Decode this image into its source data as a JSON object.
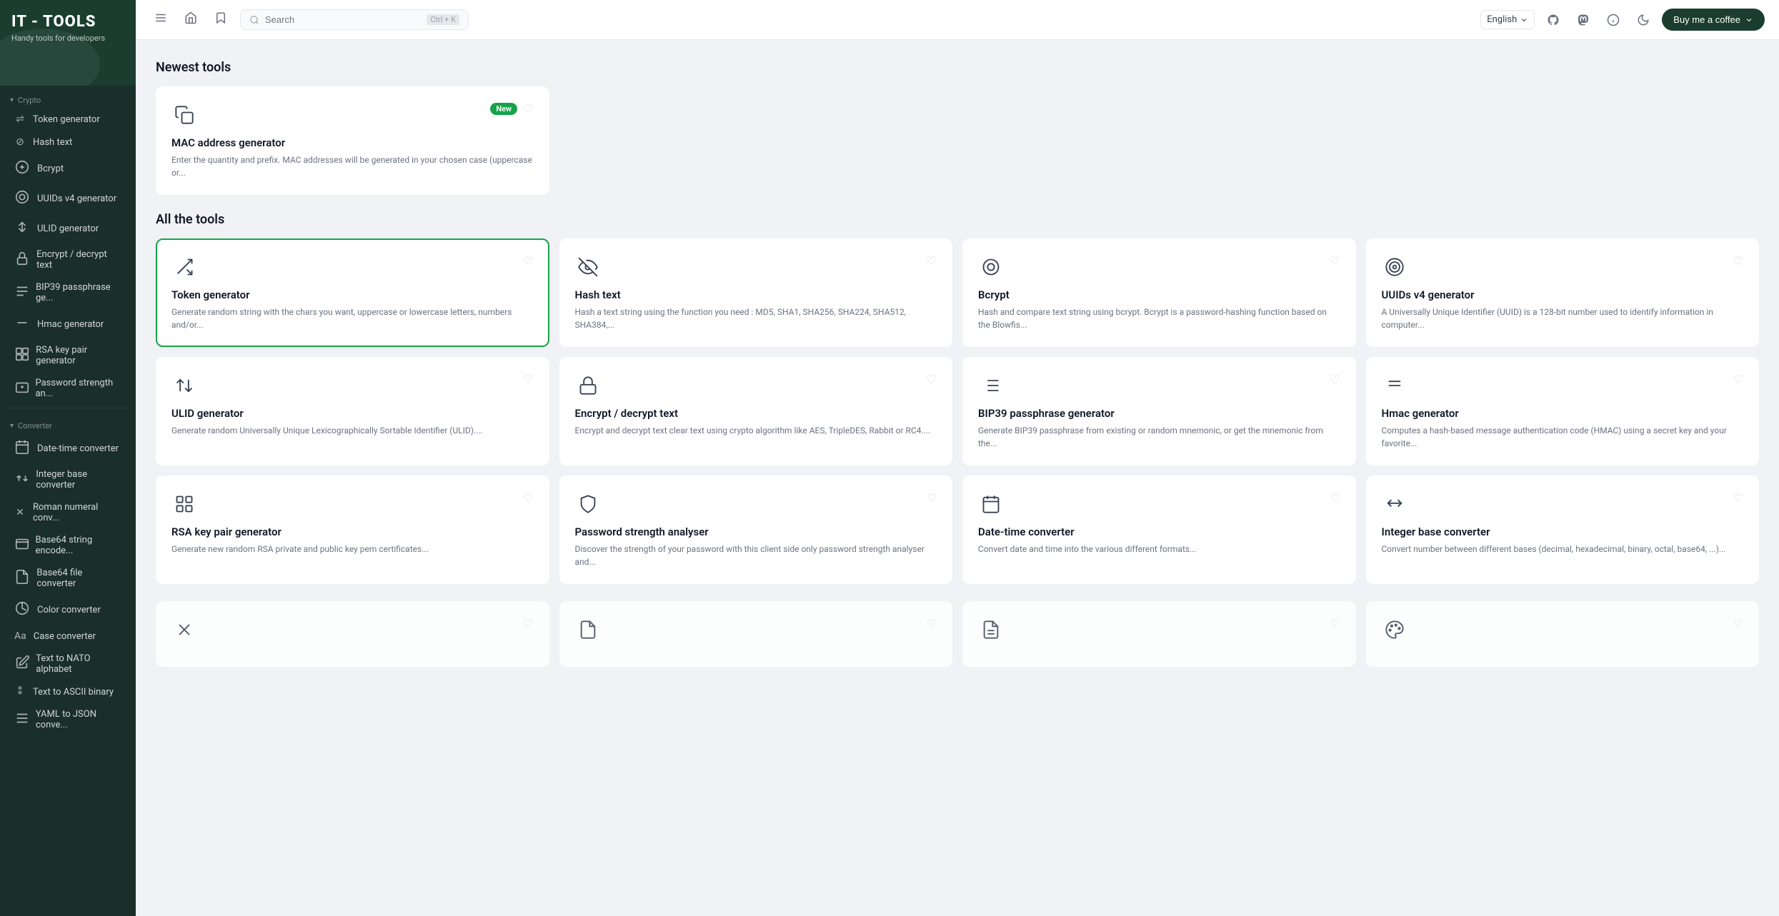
{
  "app": {
    "title": "IT - TOOLS",
    "subtitle": "Handy tools for developers"
  },
  "topbar": {
    "search_placeholder": "Search",
    "search_shortcut": "Ctrl + K",
    "language": "English",
    "buy_coffee_label": "Buy me a coffee"
  },
  "sidebar": {
    "sections": [
      {
        "label": "Crypto",
        "items": [
          {
            "id": "token-generator",
            "label": "Token generator",
            "icon": "⇌"
          },
          {
            "id": "hash-text",
            "label": "Hash text",
            "icon": "⊘"
          },
          {
            "id": "bcrypt",
            "label": "Bcrypt",
            "icon": "B"
          },
          {
            "id": "uuids-v4",
            "label": "UUIDs v4 generator",
            "icon": "◎"
          },
          {
            "id": "ulid-generator",
            "label": "ULID generator",
            "icon": "↑↓"
          },
          {
            "id": "encrypt-decrypt",
            "label": "Encrypt / decrypt text",
            "icon": "🔒"
          },
          {
            "id": "bip39",
            "label": "BIP39 passphrase ge...",
            "icon": "≡"
          },
          {
            "id": "hmac-generator",
            "label": "Hmac generator",
            "icon": "—"
          },
          {
            "id": "rsa-key-pair",
            "label": "RSA key pair generator",
            "icon": "⊞"
          },
          {
            "id": "password-strength",
            "label": "Password strength an...",
            "icon": "⊡"
          }
        ]
      },
      {
        "label": "Converter",
        "items": [
          {
            "id": "date-time-converter",
            "label": "Date-time converter",
            "icon": "▦"
          },
          {
            "id": "integer-base-converter",
            "label": "Integer base converter",
            "icon": "↕"
          },
          {
            "id": "roman-numeral",
            "label": "Roman numeral conv...",
            "icon": "✕"
          },
          {
            "id": "base64-string",
            "label": "Base64 string encode...",
            "icon": "▣"
          },
          {
            "id": "base64-file",
            "label": "Base64 file converter",
            "icon": "▤"
          },
          {
            "id": "color-converter",
            "label": "Color converter",
            "icon": "◑"
          },
          {
            "id": "case-converter",
            "label": "Case converter",
            "icon": "Aa"
          },
          {
            "id": "text-to-nato",
            "label": "Text to NATO alphabet",
            "icon": "📢"
          },
          {
            "id": "text-to-ascii",
            "label": "Text to ASCII binary",
            "icon": "⁑"
          },
          {
            "id": "yaml-to-json",
            "label": "YAML to JSON conve...",
            "icon": "≡"
          }
        ]
      }
    ]
  },
  "newest_section": {
    "title": "Newest tools",
    "cards": [
      {
        "id": "mac-address-generator",
        "title": "MAC address generator",
        "desc": "Enter the quantity and prefix. MAC addresses will be generated in your chosen case (uppercase or...",
        "icon": "copy",
        "is_new": true
      }
    ]
  },
  "all_tools_section": {
    "title": "All the tools",
    "cards": [
      {
        "id": "token-generator",
        "title": "Token generator",
        "desc": "Generate random string with the chars you want, uppercase or lowercase letters, numbers and/or...",
        "icon": "shuffle",
        "highlighted": true
      },
      {
        "id": "hash-text",
        "title": "Hash text",
        "desc": "Hash a text string using the function you need : MD5, SHA1, SHA256, SHA224, SHA512, SHA384,...",
        "icon": "eye-off"
      },
      {
        "id": "bcrypt",
        "title": "Bcrypt",
        "desc": "Hash and compare text string using bcrypt. Bcrypt is a password-hashing function based on the Blowfis...",
        "icon": "fingerprint"
      },
      {
        "id": "uuids-v4-generator",
        "title": "UUIDs v4 generator",
        "desc": "A Universally Unique Identifier (UUID) is a 128-bit number used to identify information in computer...",
        "icon": "fingerprint2"
      },
      {
        "id": "ulid-generator",
        "title": "ULID generator",
        "desc": "Generate random Universally Unique Lexicographically Sortable Identifier (ULID)....",
        "icon": "sort-asc"
      },
      {
        "id": "encrypt-decrypt-text",
        "title": "Encrypt / decrypt text",
        "desc": "Encrypt and decrypt text clear text using crypto algorithm like AES, TripleDES, Rabbit or RC4....",
        "icon": "lock"
      },
      {
        "id": "bip39-passphrase",
        "title": "BIP39 passphrase generator",
        "desc": "Generate BIP39 passphrase from existing or random mnemonic, or get the mnemonic from the...",
        "icon": "list"
      },
      {
        "id": "hmac-generator",
        "title": "Hmac generator",
        "desc": "Computes a hash-based message authentication code (HMAC) using a secret key and your favorite...",
        "icon": "minus"
      },
      {
        "id": "rsa-key-pair",
        "title": "RSA key pair generator",
        "desc": "Generate new random RSA private and public key pem certificates...",
        "icon": "grid"
      },
      {
        "id": "password-strength",
        "title": "Password strength analyser",
        "desc": "Discover the strength of your password with this client side only password strength analyser and...",
        "icon": "shield"
      },
      {
        "id": "date-time-converter",
        "title": "Date-time converter",
        "desc": "Convert date and time into the various different formats...",
        "icon": "calendar"
      },
      {
        "id": "integer-base-converter",
        "title": "Integer base converter",
        "desc": "Convert number between different bases (decimal, hexadecimal, binary, octal, base64, ...)...",
        "icon": "arrows-lr"
      }
    ]
  }
}
